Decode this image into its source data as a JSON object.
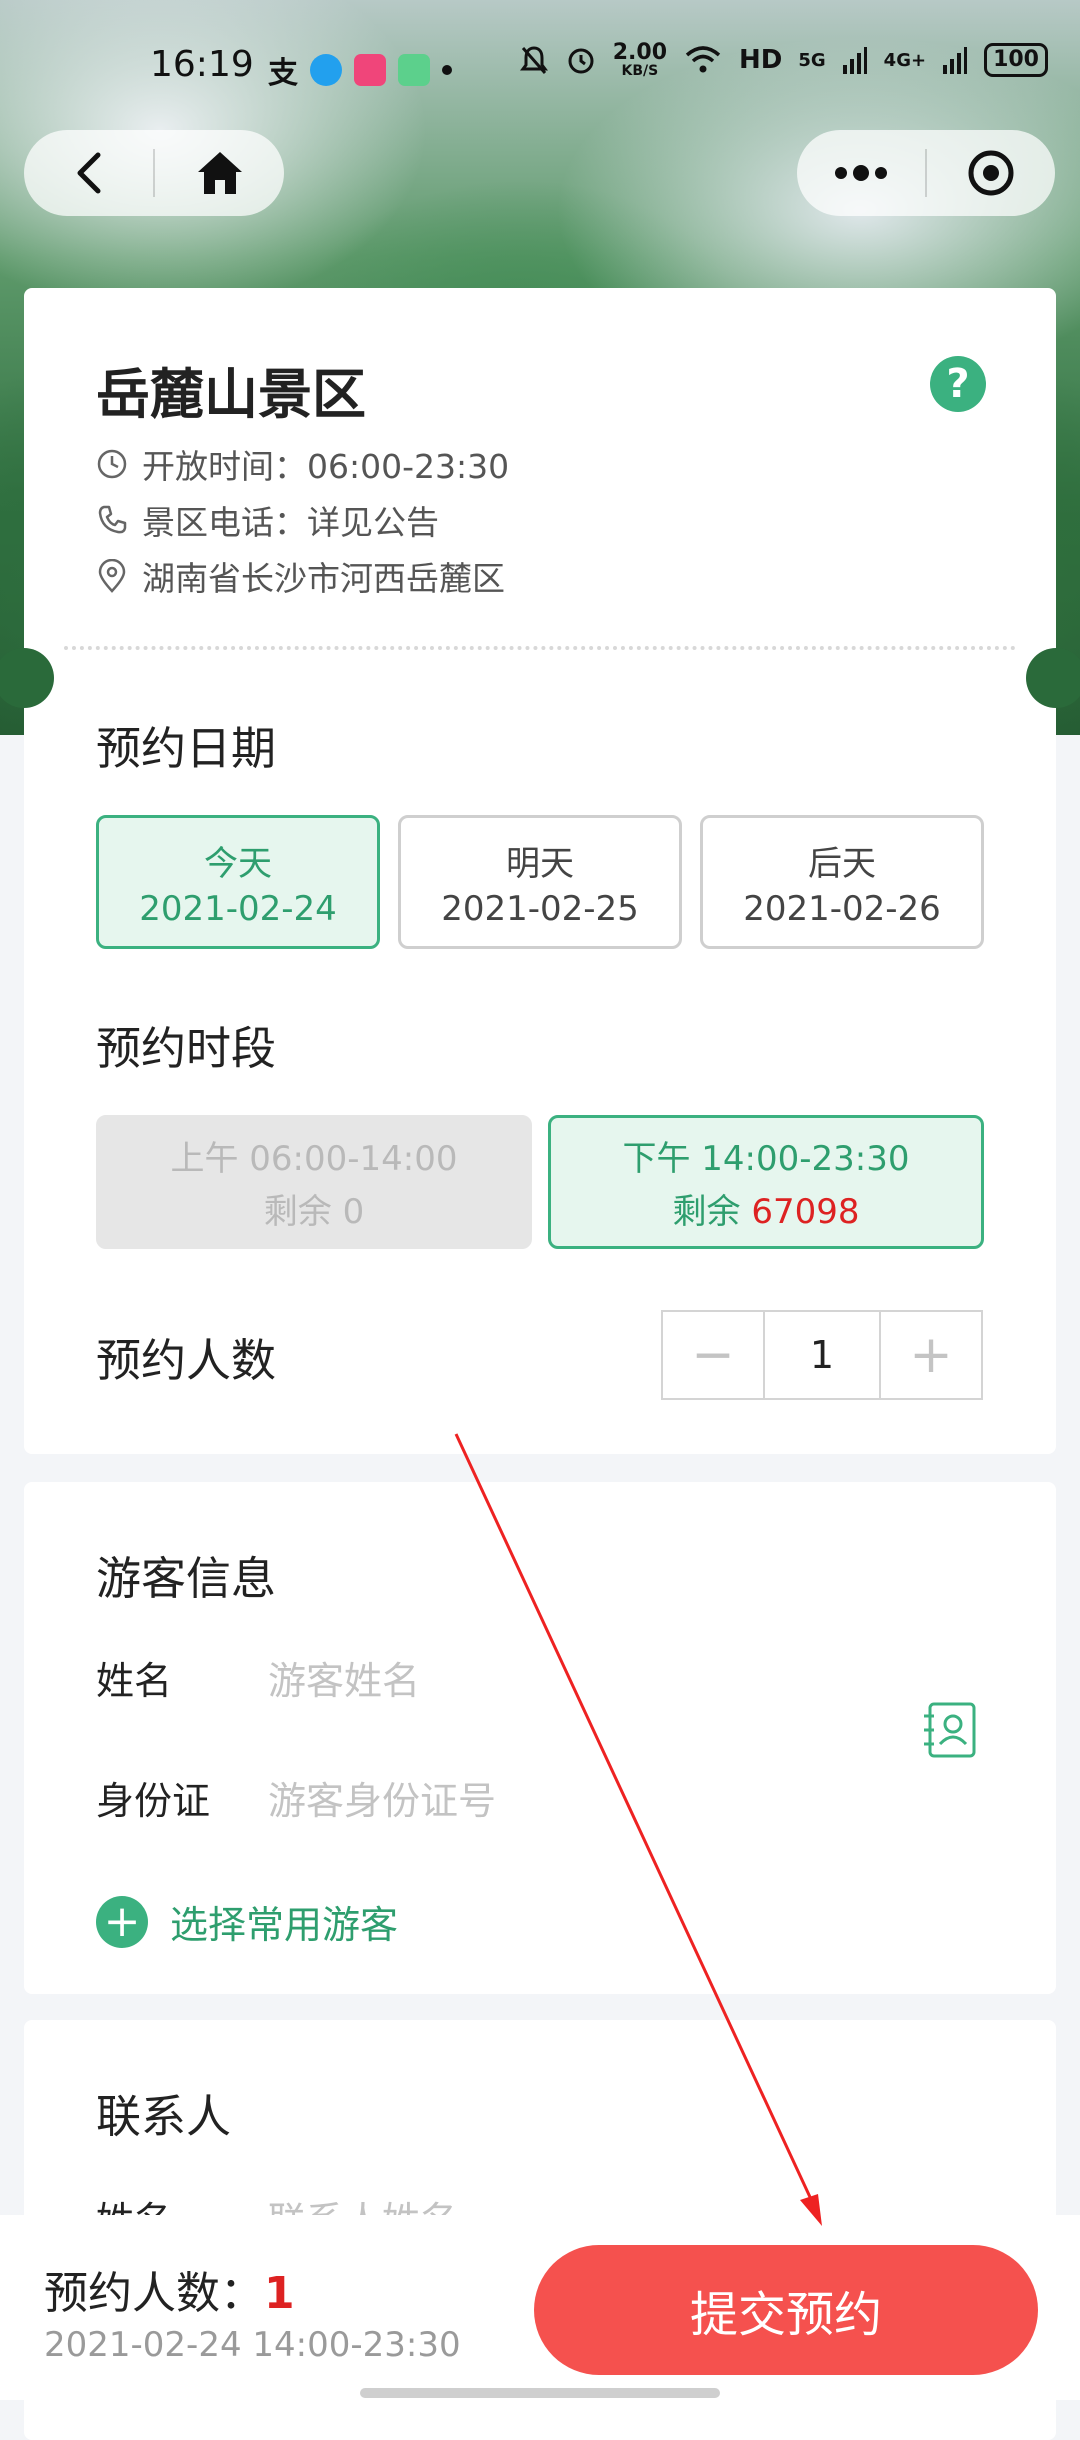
{
  "status_bar": {
    "time": "16:19",
    "net_speed": "2.00",
    "net_unit": "KB/S",
    "hd": "HD",
    "signal_5g": "5G",
    "signal_4g": "4G+",
    "battery": "100"
  },
  "scenic": {
    "title": "岳麓山景区",
    "open_time": "开放时间：06:00-23:30",
    "phone": "景区电话：详见公告",
    "address": "湖南省长沙市河西岳麓区"
  },
  "date_section": {
    "title": "预约日期",
    "options": [
      {
        "label": "今天",
        "date": "2021-02-24"
      },
      {
        "label": "明天",
        "date": "2021-02-25"
      },
      {
        "label": "后天",
        "date": "2021-02-26"
      }
    ]
  },
  "time_section": {
    "title": "预约时段",
    "slots": [
      {
        "label": "上午 06:00-14:00",
        "remain_text": "剩余 ",
        "remain_num": "0"
      },
      {
        "label": "下午 14:00-23:30",
        "remain_text": "剩余 ",
        "remain_num": "67098"
      }
    ]
  },
  "count_section": {
    "title": "预约人数",
    "minus": "−",
    "value": "1",
    "plus": "+"
  },
  "visitor": {
    "title": "游客信息",
    "name_label": "姓名",
    "name_placeholder": "游客姓名",
    "id_label": "身份证",
    "id_placeholder": "游客身份证号",
    "add_label": "选择常用游客"
  },
  "contact": {
    "title": "联系人",
    "name_label": "姓名",
    "name_placeholder": "联系人姓名"
  },
  "bottom": {
    "count_label": "预约人数：",
    "count_value": "1",
    "summary": "2021-02-24 14:00-23:30",
    "submit": "提交预约"
  },
  "colors": {
    "accent": "#3bb180",
    "submit": "#f5514e",
    "remain": "#dd2222"
  }
}
